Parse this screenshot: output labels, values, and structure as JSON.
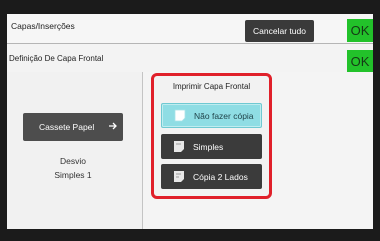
{
  "header": {
    "title": "Capas/Inserções",
    "cancel_all": "Cancelar tudo",
    "ok": "OK"
  },
  "subheader": {
    "title": "Definição De Capa Frontal",
    "ok": "OK"
  },
  "left_panel": {
    "cassette_button": "Cassete Papel",
    "tray_name": "Desvio",
    "tray_type": "Simples 1"
  },
  "print_front_cover": {
    "label": "Imprimir Capa Frontal",
    "options": [
      {
        "label": "Não fazer cópia",
        "selected": true,
        "icon": "blank-page-icon"
      },
      {
        "label": "Simples",
        "selected": false,
        "icon": "single-sided-page-icon"
      },
      {
        "label": "Cópia 2 Lados",
        "selected": false,
        "icon": "two-sided-page-icon"
      }
    ]
  },
  "colors": {
    "ok_green": "#22c22a",
    "selected": "#8fdde4",
    "highlight_border": "#e0202a",
    "dark_button": "#3b3b3b"
  }
}
